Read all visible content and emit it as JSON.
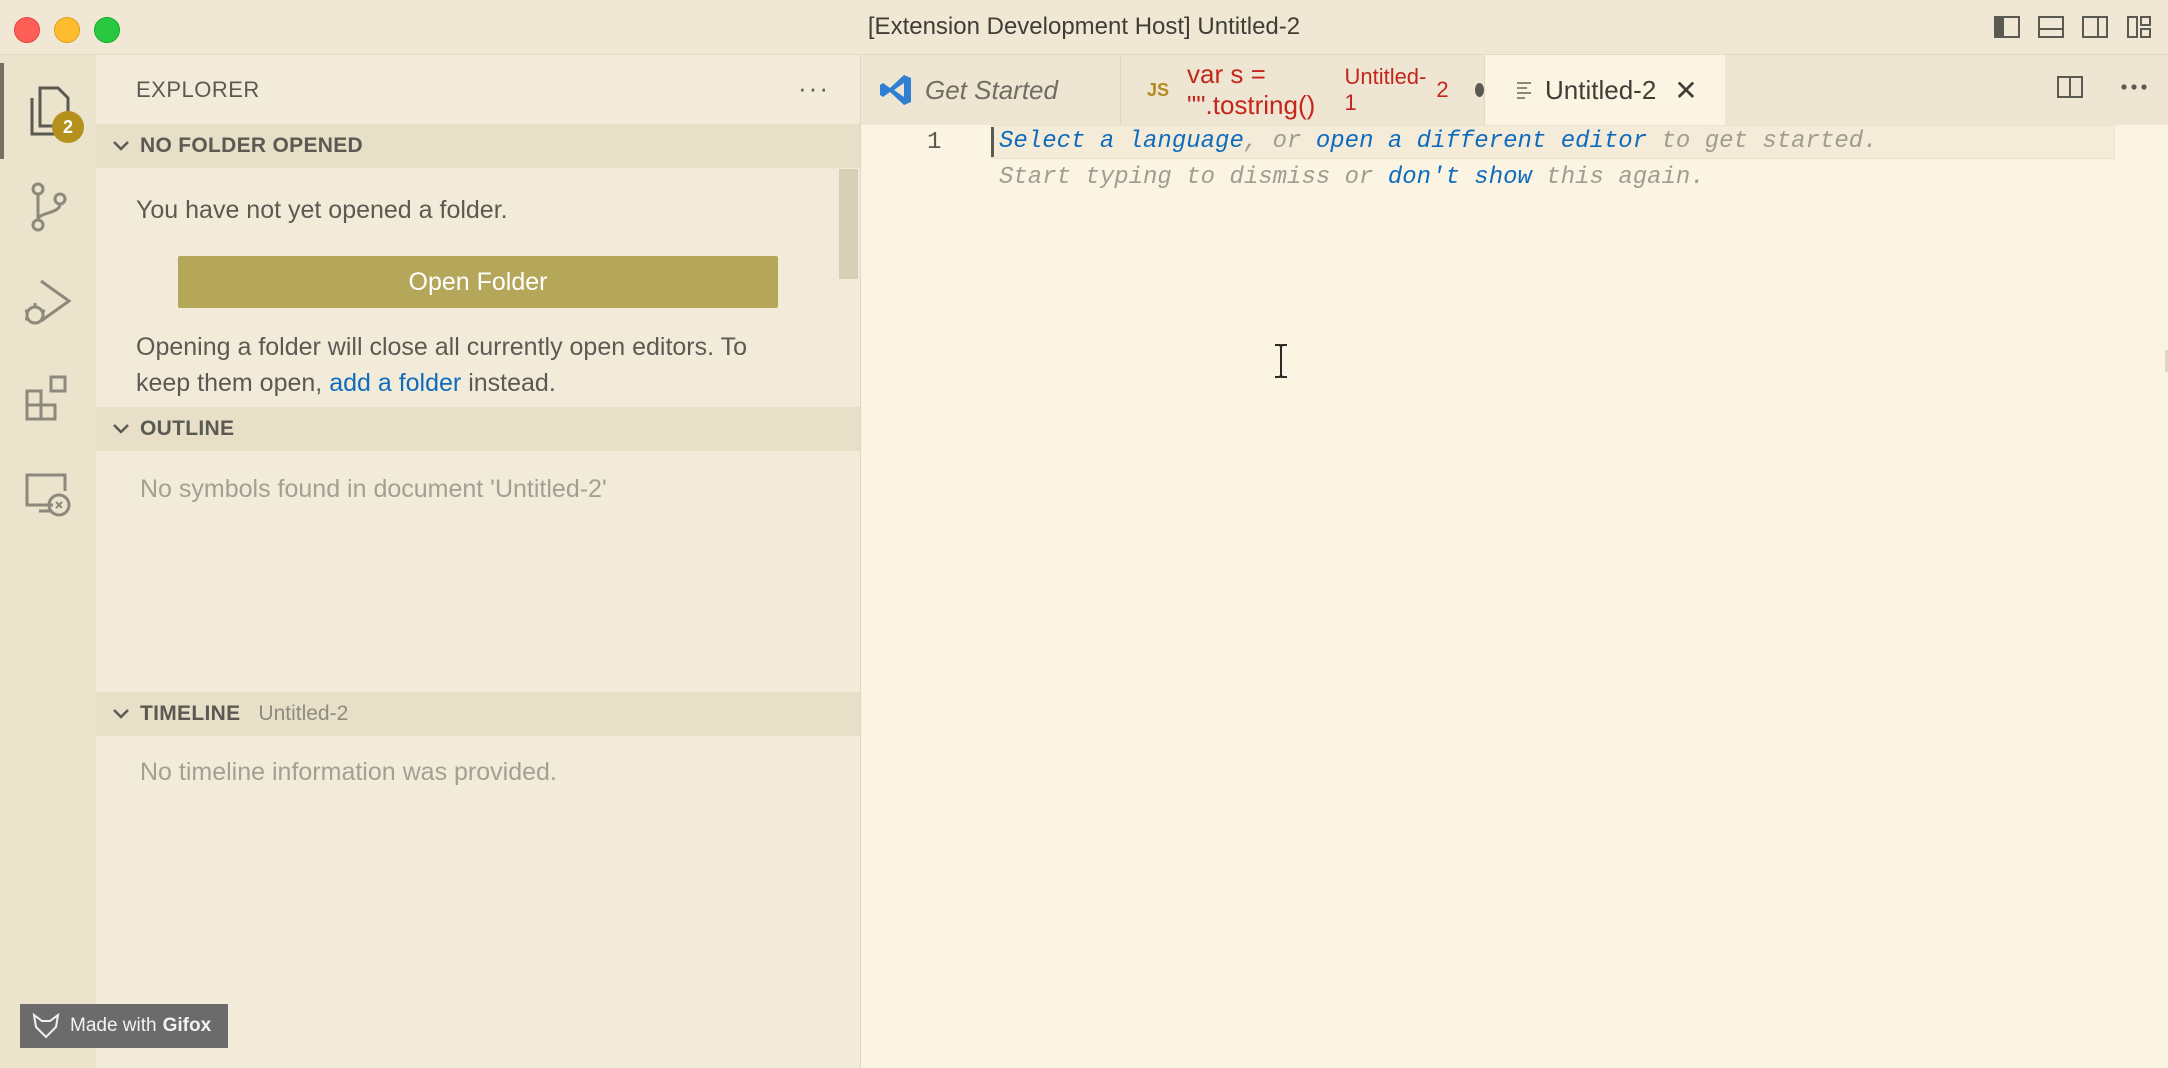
{
  "window": {
    "title": "[Extension Development Host] Untitled-2"
  },
  "activity": {
    "explorer_badge": "2"
  },
  "sidebar": {
    "header": "EXPLORER",
    "more": "···",
    "no_folder": {
      "title": "NO FOLDER OPENED",
      "message": "You have not yet opened a folder.",
      "button": "Open Folder",
      "note_line1": "Opening a folder will close all currently open editors. To",
      "note_line2_pre": "keep them open,",
      "note_link": "add a folder",
      "note_line2_post": "instead."
    },
    "outline": {
      "title": "OUTLINE",
      "empty": "No symbols found in document 'Untitled-2'"
    },
    "timeline": {
      "title": "TIMELINE",
      "subtitle": "Untitled-2",
      "empty": "No timeline information was provided."
    }
  },
  "tabs": [
    {
      "label": "Get Started"
    },
    {
      "badge": "JS",
      "label": "var s = \"\".tostring()",
      "description": "Untitled-1",
      "problems": "2"
    },
    {
      "label": "Untitled-2"
    }
  ],
  "editor": {
    "line_number": "1",
    "hint_line1": {
      "link1": "Select a language",
      "mid": ", or ",
      "link2": "open a different editor",
      "end": " to get started."
    },
    "hint_line2": {
      "start": "Start typing to dismiss or ",
      "link": "don't show",
      "end": " this again."
    }
  },
  "watermark": {
    "prefix": "Made with",
    "brand": "Gifox"
  },
  "colors": {
    "accent_button": "#b5a75a",
    "badge": "#b4911c",
    "link": "#0f6cbd",
    "error_tab": "#c4261b"
  }
}
